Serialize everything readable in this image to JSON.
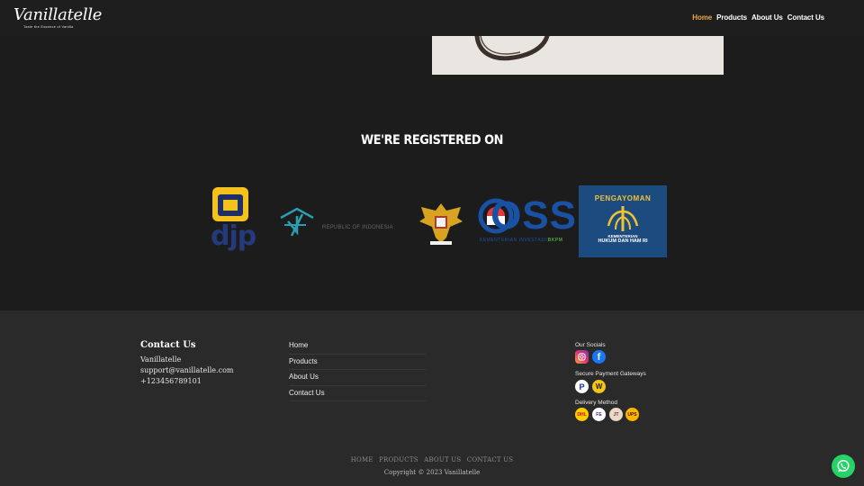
{
  "header": {
    "brand": "Vanillatelle",
    "tagline": "Taste the Essence of Vanilla",
    "nav": [
      {
        "label": "Home",
        "active": true
      },
      {
        "label": "Products",
        "active": false
      },
      {
        "label": "About Us",
        "active": false
      },
      {
        "label": "Contact Us",
        "active": false
      }
    ]
  },
  "registered": {
    "title": "WE'RE REGISTERED ON",
    "logos": [
      {
        "name": "djp-logo",
        "text": "djp"
      },
      {
        "name": "ministry-logo",
        "text": "REPUBLIC OF INDONESIA"
      },
      {
        "name": "garuda-emblem",
        "text": ""
      },
      {
        "name": "oss-logo",
        "text": "OSS",
        "subtext": "KEMENTERIAN INVESTASI/",
        "subtext_accent": "BKPM"
      },
      {
        "name": "pengayoman-logo",
        "text": "PENGAYOMAN",
        "subtext1": "KEMENTERIAN",
        "subtext2": "HUKUM DAN HAM RI"
      }
    ]
  },
  "footer": {
    "contact": {
      "heading": "Contact Us",
      "name": "Vanillatelle",
      "email": "support@vanillatelle.com",
      "phone": "+123456789101"
    },
    "links": [
      "Home",
      "Products",
      "About Us",
      "Contact Us"
    ],
    "socials_label": "Our Socials",
    "payment_label": "Secure Payment Gateways",
    "delivery_label": "Delivery Method",
    "bottom_nav": [
      "HOME",
      "PRODUCTS",
      "ABOUT US",
      "CONTACT US"
    ],
    "copyright": "Copyright © 2023 Vanillatelle"
  },
  "colors": {
    "accent": "#e8a64a",
    "background": "#1c1c1c",
    "footer": "#2a2a2a",
    "whatsapp": "#25d366"
  },
  "icons": {
    "socials": [
      "instagram-icon",
      "facebook-icon"
    ],
    "payments": [
      "paypal-icon",
      "wallet-icon"
    ],
    "delivery": [
      "dhl-icon",
      "fedex-icon",
      "courier-icon",
      "ups-icon"
    ],
    "chat": "whatsapp-icon"
  }
}
